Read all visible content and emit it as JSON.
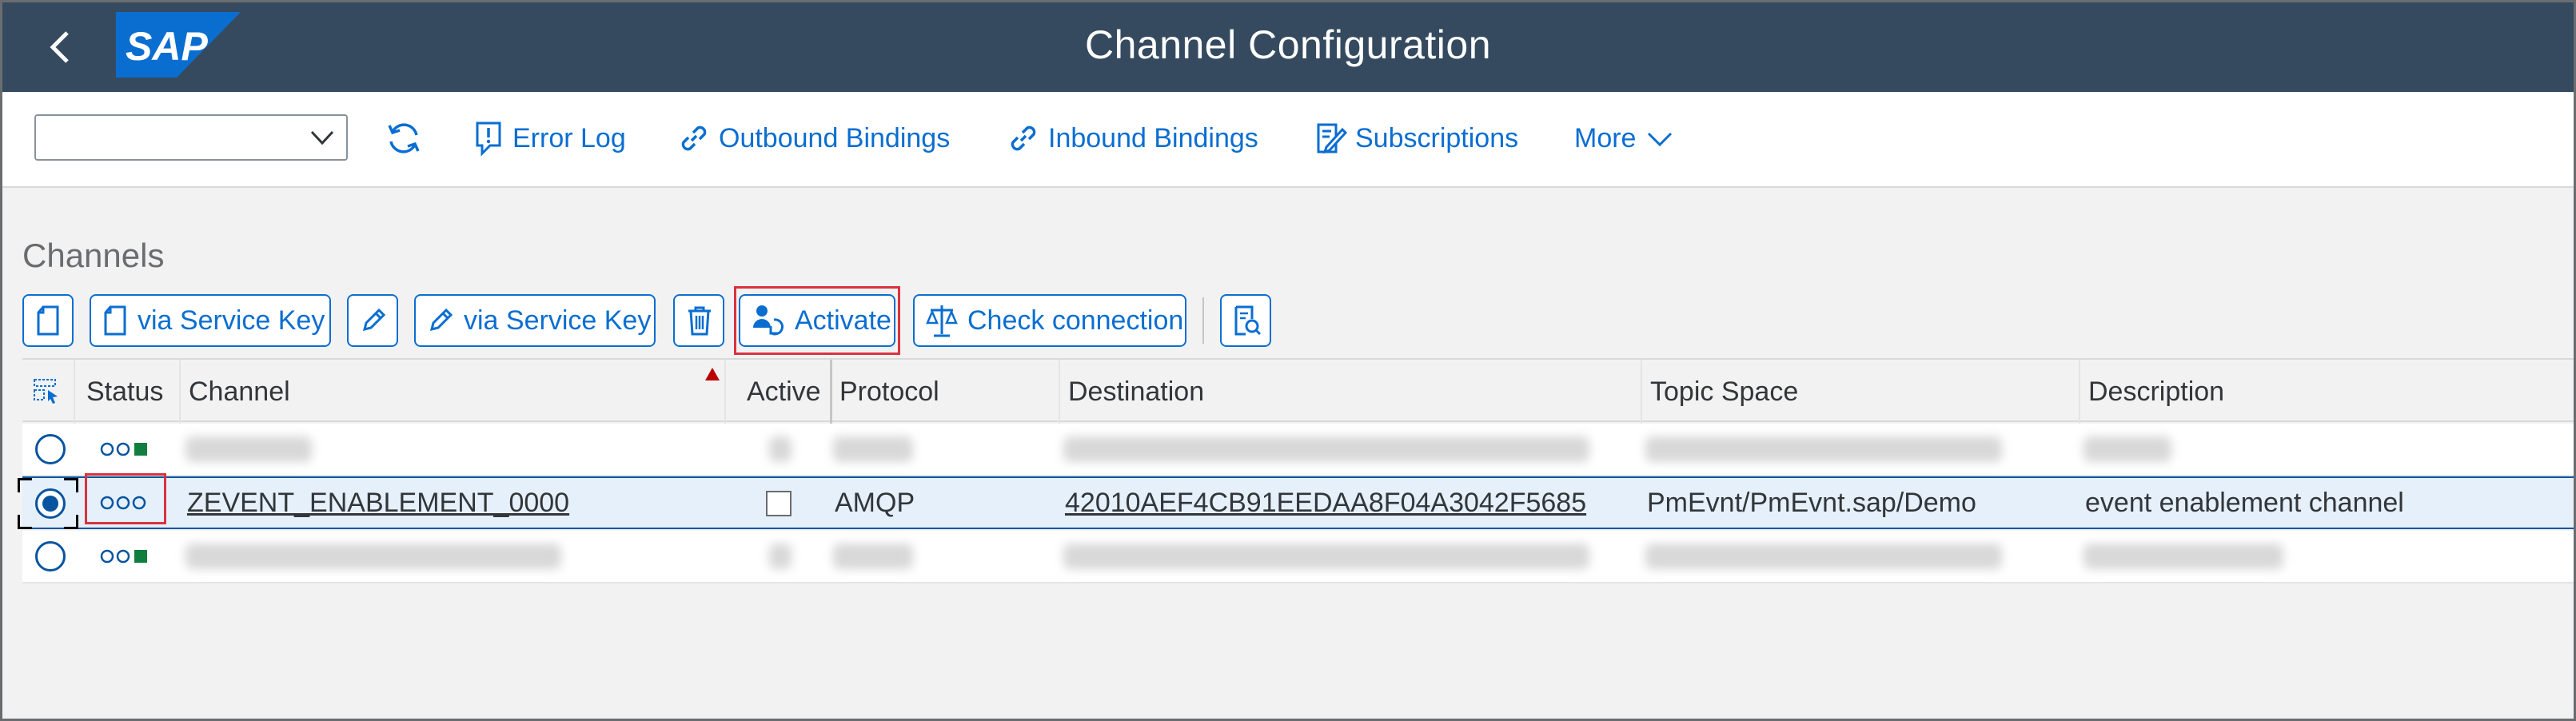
{
  "shell": {
    "title": "Channel Configuration",
    "logo_text": "SAP",
    "back_icon": "chevron-left-icon",
    "colors": {
      "header_bg": "#354a5f",
      "logo_blue": "#0a6ed1"
    }
  },
  "toolbar": {
    "select_value": "",
    "refresh_icon": "refresh-icon",
    "items": [
      {
        "label": "Error Log",
        "icon": "error-log-icon"
      },
      {
        "label": "Outbound Bindings",
        "icon": "link-icon"
      },
      {
        "label": "Inbound Bindings",
        "icon": "link-icon"
      },
      {
        "label": "Subscriptions",
        "icon": "subscriptions-icon"
      },
      {
        "label": "More",
        "icon": "chevron-down-icon"
      }
    ]
  },
  "channels": {
    "title": "Channels",
    "buttons": {
      "create_icon": "document-icon",
      "create_via_key": "via Service Key",
      "edit_icon": "pencil-icon",
      "edit_via_key": "via Service Key",
      "delete_icon": "trash-icon",
      "activate": "Activate",
      "check_connection": "Check connection",
      "inspect_icon": "inspect-document-icon"
    },
    "columns": {
      "status": "Status",
      "channel": "Channel",
      "active": "Active",
      "protocol": "Protocol",
      "destination": "Destination",
      "topic_space": "Topic Space",
      "description": "Description"
    },
    "selected_row": {
      "channel": "ZEVENT_ENABLEMENT_0000",
      "active": false,
      "protocol": "AMQP",
      "destination": "42010AEF4CB91EEDAA8F04A3042F5685",
      "topic_space": "PmEvnt/PmEvnt.sap/Demo",
      "description": "event enablement channel"
    },
    "status_colors": {
      "inactive": "#0854a0",
      "active_square": "#107e3e",
      "highlight": "#d9333e"
    }
  }
}
